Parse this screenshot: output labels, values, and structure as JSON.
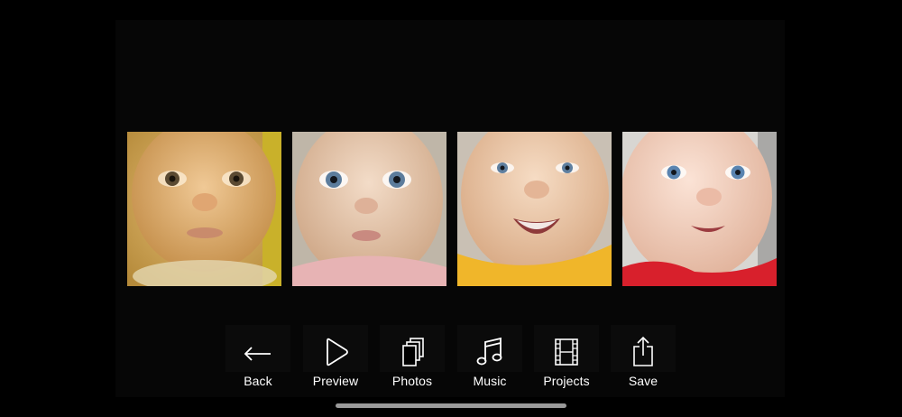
{
  "toolbar": {
    "back_label": "Back",
    "preview_label": "Preview",
    "photos_label": "Photos",
    "music_label": "Music",
    "projects_label": "Projects",
    "save_label": "Save"
  },
  "icons": {
    "back": "arrow-left-icon",
    "preview": "play-icon",
    "photos": "stacked-photos-icon",
    "music": "music-note-icon",
    "projects": "film-strip-icon",
    "save": "share-icon"
  },
  "colors": {
    "background": "#000000",
    "text": "#ffffff",
    "icon": "#ffffff",
    "home_indicator": "#9a9a9a"
  }
}
